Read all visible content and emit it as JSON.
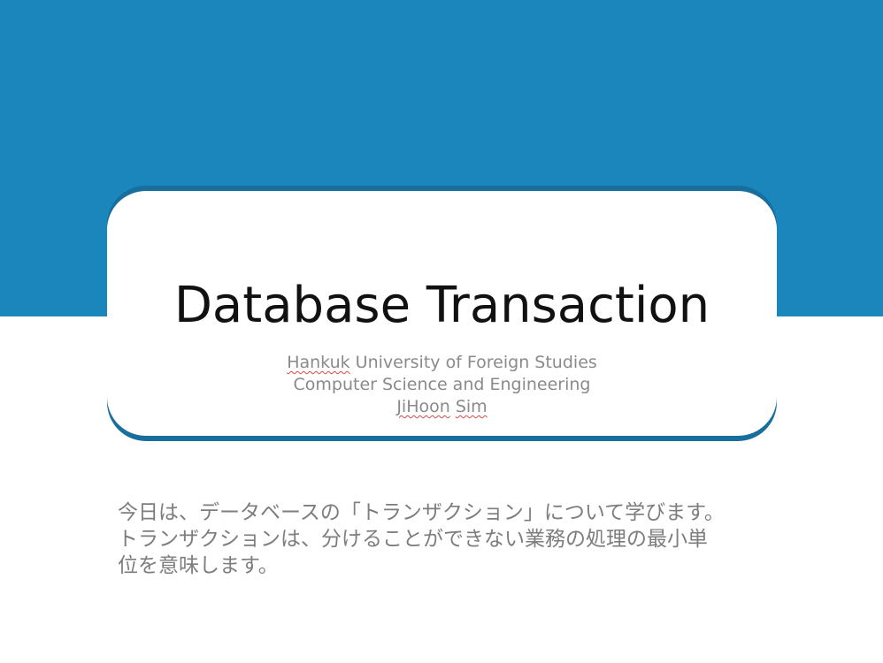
{
  "slide": {
    "title": "Database Transaction",
    "subtitle": {
      "line1_marked": "Hankuk",
      "line1_rest": " University of Foreign Studies",
      "line2": "Computer Science and Engineering",
      "line3_marked": "JiHoon",
      "line3_space": " ",
      "line3_marked2": "Sim"
    },
    "body_lines": [
      "今日は、データベースの「トランザクション」について学びます。",
      "トランザクションは、分けることができない業務の処理の最小単",
      "位を意味します。"
    ]
  },
  "colors": {
    "band": "#1a86bb",
    "card_edge": "#186f9e",
    "spellcheck": "#d94a4a"
  }
}
